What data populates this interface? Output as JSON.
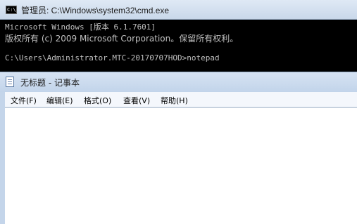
{
  "cmd": {
    "title": "管理员: C:\\Windows\\system32\\cmd.exe",
    "icon": "cmd-icon",
    "icon_text": "C:\\",
    "lines": [
      "Microsoft Windows [版本 6.1.7601]",
      "版权所有 (c) 2009 Microsoft Corporation。保留所有权利。",
      "C:\\Users\\Administrator.MTC-20170707HOD>notepad"
    ]
  },
  "notepad": {
    "title": "无标题 - 记事本",
    "icon": "notepad-icon",
    "menu": [
      "文件(F)",
      "编辑(E)",
      "格式(O)",
      "查看(V)",
      "帮助(H)"
    ],
    "content": ""
  },
  "colors": {
    "console_bg": "#000000",
    "console_fg": "#c0c0c0",
    "titlebar": "#c9d8ea",
    "editor_bg": "#ffffff"
  }
}
